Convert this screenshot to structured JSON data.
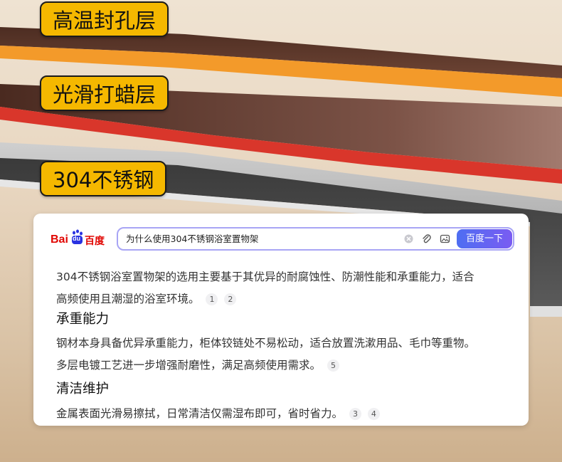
{
  "labels": {
    "coating_layer": "高温封孔层",
    "smooth_layer": "光滑打蜡层",
    "steel_layer": "304不锈钢"
  },
  "search": {
    "logo_text_left": "Bai",
    "logo_text_mid": "du",
    "logo_text_right": "百度",
    "query": "为什么使用304不锈钢浴室置物架",
    "button_label": "百度一下"
  },
  "answer": {
    "intro_line1": "304不锈钢浴室置物架的选用主要基于其优异的耐腐蚀性、防潮性能和承重能力，适合",
    "intro_line2": "高频使用且潮湿的浴室环境。",
    "intro_cites": [
      "1",
      "2"
    ],
    "section1_title": "承重能力",
    "section1_line1": "钢材本身具备优异承重能力，柜体铰链处不易松动，适合放置洗漱用品、毛巾等重物。",
    "section1_line2": "多层电镀工艺进一步增强耐磨性，满足高频使用需求。",
    "section1_cites": [
      "5"
    ],
    "section2_title": "清洁维护",
    "section2_line1": "金属表面光滑易擦拭，日常清洁仅需湿布即可，省时省力。",
    "section2_cites": [
      "3",
      "4"
    ]
  },
  "colors": {
    "tag_bg": "#f5b800",
    "search_border": "#a8a5f5",
    "button_start": "#4e6ef2",
    "button_end": "#7a5cf2",
    "orange_layer": "#f39a2a",
    "red_layer": "#d9362b",
    "brown_layer": "#5a3428"
  },
  "icons": [
    "clear-icon",
    "attachment-icon",
    "image-search-icon",
    "baidu-paw-icon"
  ]
}
